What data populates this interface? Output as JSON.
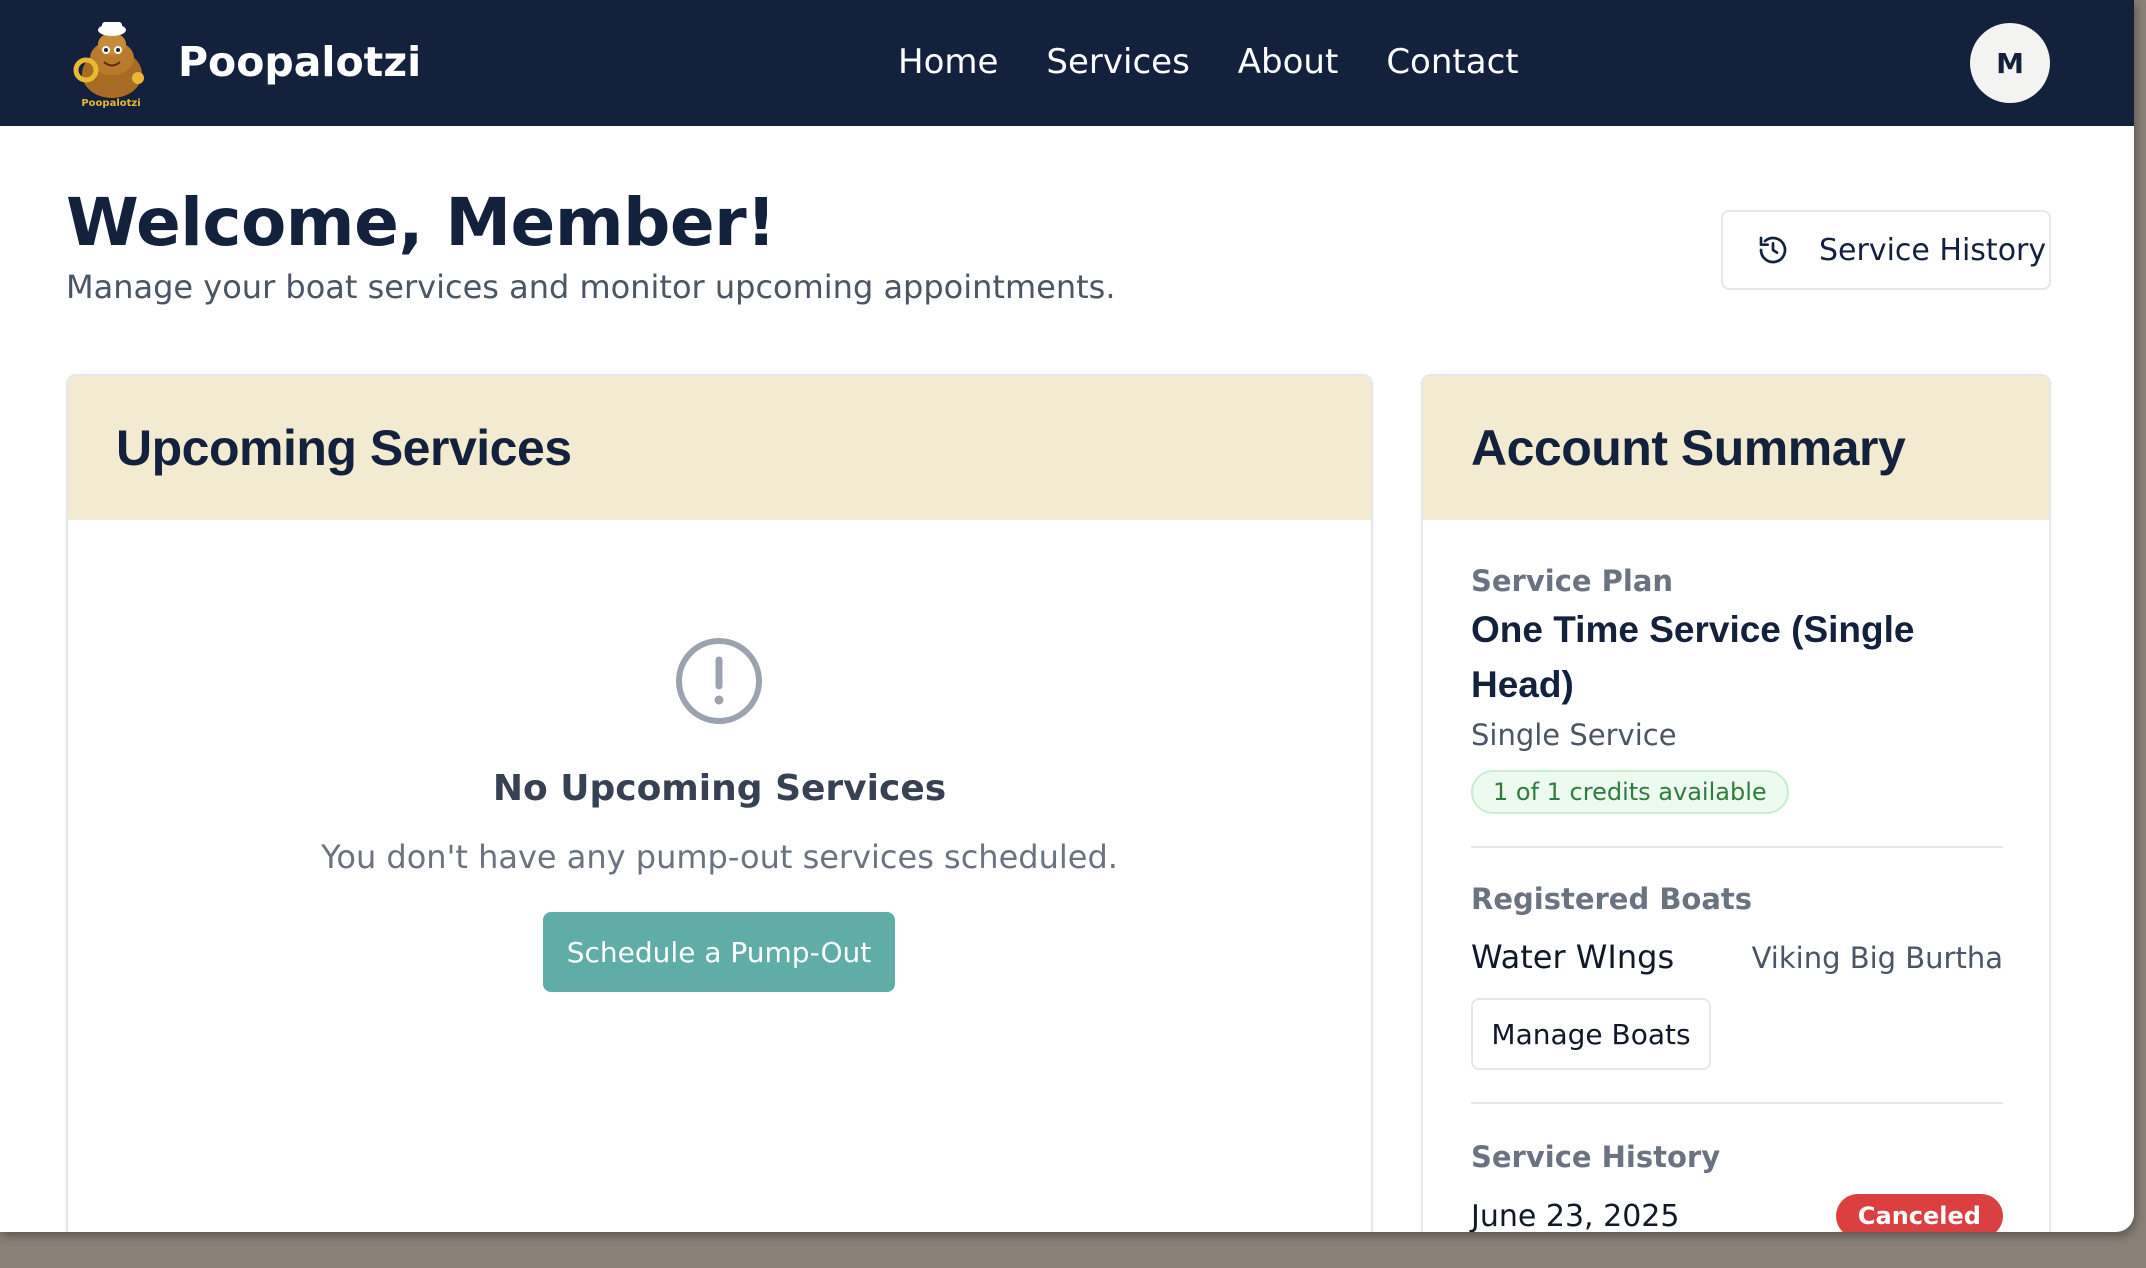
{
  "navbar": {
    "brand": "Poopalotzi",
    "logo_text": "Poopalotzi",
    "links": [
      "Home",
      "Services",
      "About",
      "Contact"
    ],
    "avatar_initial": "M",
    "background": "#13213c"
  },
  "header": {
    "title": "Welcome, Member!",
    "subtitle": "Manage your boat services and monitor upcoming appointments.",
    "history_button": "Service History"
  },
  "upcoming": {
    "title": "Upcoming Services",
    "empty_title": "No Upcoming Services",
    "empty_text": "You don't have any pump-out services scheduled.",
    "schedule_button": "Schedule a Pump-Out",
    "accent": "#5fada6"
  },
  "account": {
    "title": "Account Summary",
    "plan_label": "Service Plan",
    "plan_name": "One Time Service (Single Head)",
    "plan_type": "Single Service",
    "credits": "1 of 1 credits available",
    "boats_label": "Registered Boats",
    "boats": [
      {
        "name": "Water WIngs",
        "model": "Viking Big Burtha"
      }
    ],
    "manage_button": "Manage Boats",
    "history_label": "Service History",
    "history": [
      {
        "date": "June 23, 2025",
        "status": "Canceled"
      }
    ],
    "card_header_color": "#f3ead2",
    "canceled_color": "#dc3f3f"
  },
  "icons": [
    "logo-mascot",
    "history-icon",
    "alert-circle-icon"
  ]
}
